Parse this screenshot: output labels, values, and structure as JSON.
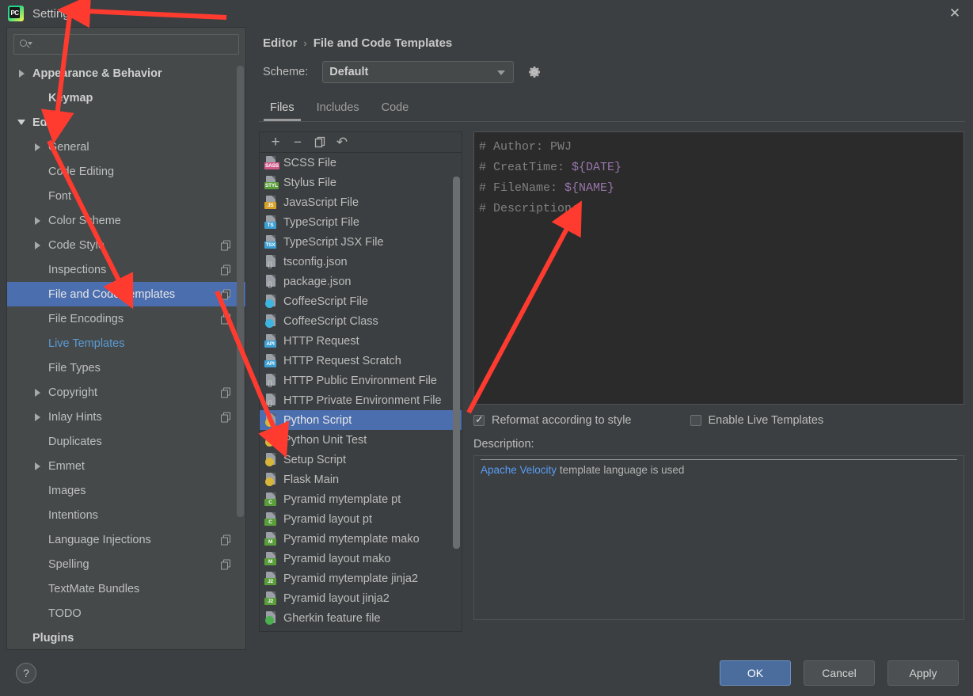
{
  "window": {
    "title": "Settings",
    "logo_icon": "pycharm-logo-icon",
    "logo_text": "PC",
    "close_icon": "close-icon"
  },
  "search": {
    "value": "",
    "placeholder": "",
    "icon": "search-icon"
  },
  "sidebar": {
    "items": [
      {
        "label": "Appearance & Behavior",
        "arrow": "right",
        "indent": 1,
        "bold": true,
        "badge": false,
        "selected": false,
        "link": false
      },
      {
        "label": "Keymap",
        "arrow": "none",
        "indent": 2,
        "bold": true,
        "badge": false,
        "selected": false,
        "link": false
      },
      {
        "label": "Editor",
        "arrow": "down",
        "indent": 1,
        "bold": true,
        "badge": false,
        "selected": false,
        "link": false
      },
      {
        "label": "General",
        "arrow": "right",
        "indent": 2,
        "bold": false,
        "badge": false,
        "selected": false,
        "link": false
      },
      {
        "label": "Code Editing",
        "arrow": "none",
        "indent": 2,
        "bold": false,
        "badge": false,
        "selected": false,
        "link": false
      },
      {
        "label": "Font",
        "arrow": "none",
        "indent": 2,
        "bold": false,
        "badge": false,
        "selected": false,
        "link": false
      },
      {
        "label": "Color Scheme",
        "arrow": "right",
        "indent": 2,
        "bold": false,
        "badge": false,
        "selected": false,
        "link": false
      },
      {
        "label": "Code Style",
        "arrow": "right",
        "indent": 2,
        "bold": false,
        "badge": true,
        "selected": false,
        "link": false
      },
      {
        "label": "Inspections",
        "arrow": "none",
        "indent": 2,
        "bold": false,
        "badge": true,
        "selected": false,
        "link": false
      },
      {
        "label": "File and Code Templates",
        "arrow": "none",
        "indent": 2,
        "bold": false,
        "badge": true,
        "selected": true,
        "link": false
      },
      {
        "label": "File Encodings",
        "arrow": "none",
        "indent": 2,
        "bold": false,
        "badge": true,
        "selected": false,
        "link": false
      },
      {
        "label": "Live Templates",
        "arrow": "none",
        "indent": 2,
        "bold": false,
        "badge": false,
        "selected": false,
        "link": true
      },
      {
        "label": "File Types",
        "arrow": "none",
        "indent": 2,
        "bold": false,
        "badge": false,
        "selected": false,
        "link": false
      },
      {
        "label": "Copyright",
        "arrow": "right",
        "indent": 2,
        "bold": false,
        "badge": true,
        "selected": false,
        "link": false
      },
      {
        "label": "Inlay Hints",
        "arrow": "right",
        "indent": 2,
        "bold": false,
        "badge": true,
        "selected": false,
        "link": false
      },
      {
        "label": "Duplicates",
        "arrow": "none",
        "indent": 2,
        "bold": false,
        "badge": false,
        "selected": false,
        "link": false
      },
      {
        "label": "Emmet",
        "arrow": "right",
        "indent": 2,
        "bold": false,
        "badge": false,
        "selected": false,
        "link": false
      },
      {
        "label": "Images",
        "arrow": "none",
        "indent": 2,
        "bold": false,
        "badge": false,
        "selected": false,
        "link": false
      },
      {
        "label": "Intentions",
        "arrow": "none",
        "indent": 2,
        "bold": false,
        "badge": false,
        "selected": false,
        "link": false
      },
      {
        "label": "Language Injections",
        "arrow": "none",
        "indent": 2,
        "bold": false,
        "badge": true,
        "selected": false,
        "link": false
      },
      {
        "label": "Spelling",
        "arrow": "none",
        "indent": 2,
        "bold": false,
        "badge": true,
        "selected": false,
        "link": false
      },
      {
        "label": "TextMate Bundles",
        "arrow": "none",
        "indent": 2,
        "bold": false,
        "badge": false,
        "selected": false,
        "link": false
      },
      {
        "label": "TODO",
        "arrow": "none",
        "indent": 2,
        "bold": false,
        "badge": false,
        "selected": false,
        "link": false
      },
      {
        "label": "Plugins",
        "arrow": "none",
        "indent": 1,
        "bold": true,
        "badge": false,
        "selected": false,
        "link": false
      }
    ]
  },
  "breadcrumb": {
    "parent": "Editor",
    "separator": "›",
    "current": "File and Code Templates"
  },
  "scheme": {
    "label": "Scheme:",
    "value": "Default",
    "gear_icon": "gear-icon",
    "dropdown_icon": "chevron-down-icon"
  },
  "tabs": [
    {
      "label": "Files",
      "active": true
    },
    {
      "label": "Includes",
      "active": false
    },
    {
      "label": "Code",
      "active": false
    }
  ],
  "list_toolbar": [
    {
      "name": "add-template-button",
      "glyph": "+"
    },
    {
      "name": "remove-template-button",
      "glyph": "−"
    },
    {
      "name": "copy-template-button",
      "glyph": "copy"
    },
    {
      "name": "reset-template-button",
      "glyph": "↶"
    }
  ],
  "templates": [
    {
      "label": "SCSS File",
      "icon": "scss-file-icon",
      "kind": "tag",
      "tag": "SASS",
      "color": "#cf5a88",
      "selected": false
    },
    {
      "label": "Stylus File",
      "icon": "stylus-file-icon",
      "kind": "tag",
      "tag": "STYL",
      "color": "#5a9e3a",
      "selected": false
    },
    {
      "label": "JavaScript File",
      "icon": "javascript-file-icon",
      "kind": "tag",
      "tag": "JS",
      "color": "#d8a229",
      "selected": false
    },
    {
      "label": "TypeScript File",
      "icon": "typescript-file-icon",
      "kind": "tag",
      "tag": "TS",
      "color": "#3d9fd4",
      "selected": false
    },
    {
      "label": "TypeScript JSX File",
      "icon": "typescript-jsx-file-icon",
      "kind": "tag",
      "tag": "TSX",
      "color": "#3d9fd4",
      "selected": false
    },
    {
      "label": "tsconfig.json",
      "icon": "json-file-icon",
      "kind": "braces",
      "tag": "{}",
      "color": "#9aa0a6",
      "selected": false
    },
    {
      "label": "package.json",
      "icon": "json-file-icon",
      "kind": "braces",
      "tag": "{}",
      "color": "#9aa0a6",
      "selected": false
    },
    {
      "label": "CoffeeScript File",
      "icon": "coffeescript-file-icon",
      "kind": "circle",
      "tag": "",
      "color": "#3eb5e0",
      "selected": false
    },
    {
      "label": "CoffeeScript Class",
      "icon": "coffeescript-class-icon",
      "kind": "circle",
      "tag": "",
      "color": "#3eb5e0",
      "selected": false
    },
    {
      "label": "HTTP Request",
      "icon": "http-request-icon",
      "kind": "tag",
      "tag": "API",
      "color": "#3d9fd4",
      "selected": false
    },
    {
      "label": "HTTP Request Scratch",
      "icon": "http-request-scratch-icon",
      "kind": "tag",
      "tag": "API",
      "color": "#3d9fd4",
      "selected": false
    },
    {
      "label": "HTTP Public Environment File",
      "icon": "http-public-env-icon",
      "kind": "braces",
      "tag": "{}",
      "color": "#9aa0a6",
      "selected": false
    },
    {
      "label": "HTTP Private Environment File",
      "icon": "http-private-env-icon",
      "kind": "braces",
      "tag": "{}",
      "color": "#9aa0a6",
      "selected": false
    },
    {
      "label": "Python Script",
      "icon": "python-file-icon",
      "kind": "circle",
      "tag": "",
      "color": "#d8b63a",
      "selected": true
    },
    {
      "label": "Python Unit Test",
      "icon": "python-file-icon",
      "kind": "circle",
      "tag": "",
      "color": "#d8b63a",
      "selected": false
    },
    {
      "label": "Setup Script",
      "icon": "python-file-icon",
      "kind": "circle",
      "tag": "",
      "color": "#d8b63a",
      "selected": false
    },
    {
      "label": "Flask Main",
      "icon": "python-file-icon",
      "kind": "circle",
      "tag": "",
      "color": "#d8b63a",
      "selected": false
    },
    {
      "label": "Pyramid mytemplate pt",
      "icon": "chameleon-template-icon",
      "kind": "tag",
      "tag": "C",
      "color": "#5a9e3a",
      "selected": false
    },
    {
      "label": "Pyramid layout pt",
      "icon": "chameleon-template-icon",
      "kind": "tag",
      "tag": "C",
      "color": "#5a9e3a",
      "selected": false
    },
    {
      "label": "Pyramid mytemplate mako",
      "icon": "mako-template-icon",
      "kind": "tag",
      "tag": "M",
      "color": "#5a9e3a",
      "selected": false
    },
    {
      "label": "Pyramid layout mako",
      "icon": "mako-template-icon",
      "kind": "tag",
      "tag": "M",
      "color": "#5a9e3a",
      "selected": false
    },
    {
      "label": "Pyramid mytemplate jinja2",
      "icon": "jinja2-template-icon",
      "kind": "tag",
      "tag": "J2",
      "color": "#5a9e3a",
      "selected": false
    },
    {
      "label": "Pyramid layout jinja2",
      "icon": "jinja2-template-icon",
      "kind": "tag",
      "tag": "J2",
      "color": "#5a9e3a",
      "selected": false
    },
    {
      "label": "Gherkin feature file",
      "icon": "gherkin-feature-icon",
      "kind": "circle",
      "tag": "",
      "color": "#4caf50",
      "selected": false
    }
  ],
  "editor": {
    "lines": [
      {
        "prefix": "# Author: PWJ",
        "var": ""
      },
      {
        "prefix": "# CreatTime: ",
        "var": "${DATE}"
      },
      {
        "prefix": "# FileName: ",
        "var": "${NAME}"
      },
      {
        "prefix": "# Description:",
        "var": ""
      }
    ]
  },
  "options": {
    "reformat": {
      "label": "Reformat according to style",
      "checked": true
    },
    "live_templates": {
      "label": "Enable Live Templates",
      "checked": false
    }
  },
  "description": {
    "label": "Description:",
    "link_text": "Apache Velocity",
    "rest_text": " template language is used"
  },
  "footer": {
    "help_label": "?",
    "ok_label": "OK",
    "cancel_label": "Cancel",
    "apply_label": "Apply"
  },
  "colors": {
    "accent_selection": "#4b6eaf",
    "link": "#589df6",
    "primary_button": "#4a6d9e",
    "annotation_arrow": "#ff3b30",
    "editor_background": "#2b2b2b",
    "dialog_background": "#3c3f41",
    "variable_token": "#9876aa"
  }
}
